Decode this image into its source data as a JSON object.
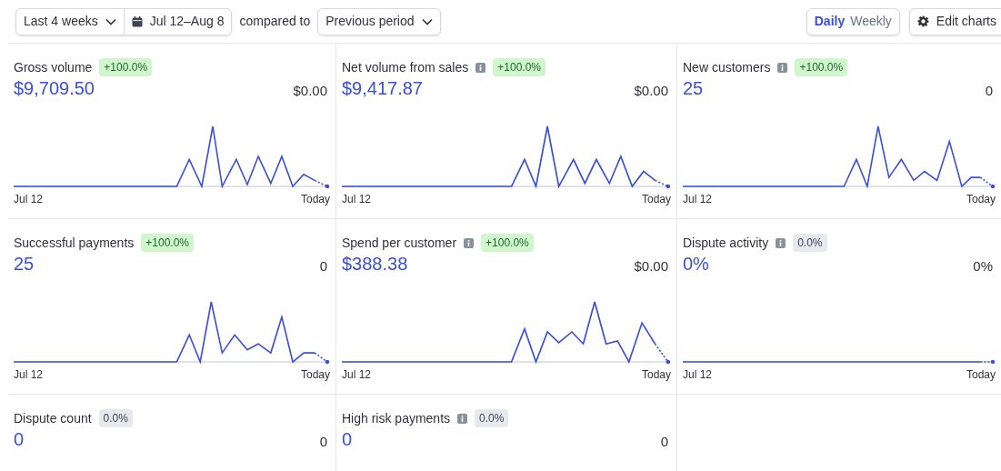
{
  "toolbar": {
    "range": "Last 4 weeks",
    "dates": "Jul 12–Aug 8",
    "compared_label": "compared to",
    "comparison": "Previous period",
    "intervals": [
      {
        "label": "Daily",
        "selected": true
      },
      {
        "label": "Weekly",
        "selected": false
      }
    ],
    "edit": "Edit charts"
  },
  "cards": [
    {
      "title": "Gross volume",
      "info": false,
      "badge": {
        "text": "+100.0%",
        "kind": "positive"
      },
      "value": "$9,709.50",
      "previous": "$0.00",
      "kind": "sparkline",
      "start": "Jul 12",
      "end": "Today"
    },
    {
      "title": "Net volume from sales",
      "info": true,
      "badge": {
        "text": "+100.0%",
        "kind": "positive"
      },
      "value": "$9,417.87",
      "previous": "$0.00",
      "kind": "sparkline",
      "start": "Jul 12",
      "end": "Today"
    },
    {
      "title": "New customers",
      "info": true,
      "badge": {
        "text": "+100.0%",
        "kind": "positive"
      },
      "value": "25",
      "previous": "0",
      "kind": "sparkline",
      "start": "Jul 12",
      "end": "Today"
    },
    {
      "title": "Successful payments",
      "info": false,
      "badge": {
        "text": "+100.0%",
        "kind": "positive"
      },
      "value": "25",
      "previous": "0",
      "kind": "sparkline",
      "start": "Jul 12",
      "end": "Today"
    },
    {
      "title": "Spend per customer",
      "info": true,
      "badge": {
        "text": "+100.0%",
        "kind": "positive"
      },
      "value": "$388.38",
      "previous": "$0.00",
      "kind": "sparkline",
      "start": "Jul 12",
      "end": "Today"
    },
    {
      "title": "Dispute activity",
      "info": true,
      "badge": {
        "text": "0.0%",
        "kind": "neutral"
      },
      "value": "0%",
      "previous": "0%",
      "kind": "sparkline",
      "start": "Jul 12",
      "end": "Today"
    },
    {
      "title": "Dispute count",
      "info": false,
      "badge": {
        "text": "0.0%",
        "kind": "neutral"
      },
      "value": "0",
      "previous": "0",
      "kind": "plain"
    },
    {
      "title": "High risk payments",
      "info": true,
      "badge": {
        "text": "0.0%",
        "kind": "neutral"
      },
      "value": "0",
      "previous": "0",
      "kind": "plain"
    }
  ]
}
